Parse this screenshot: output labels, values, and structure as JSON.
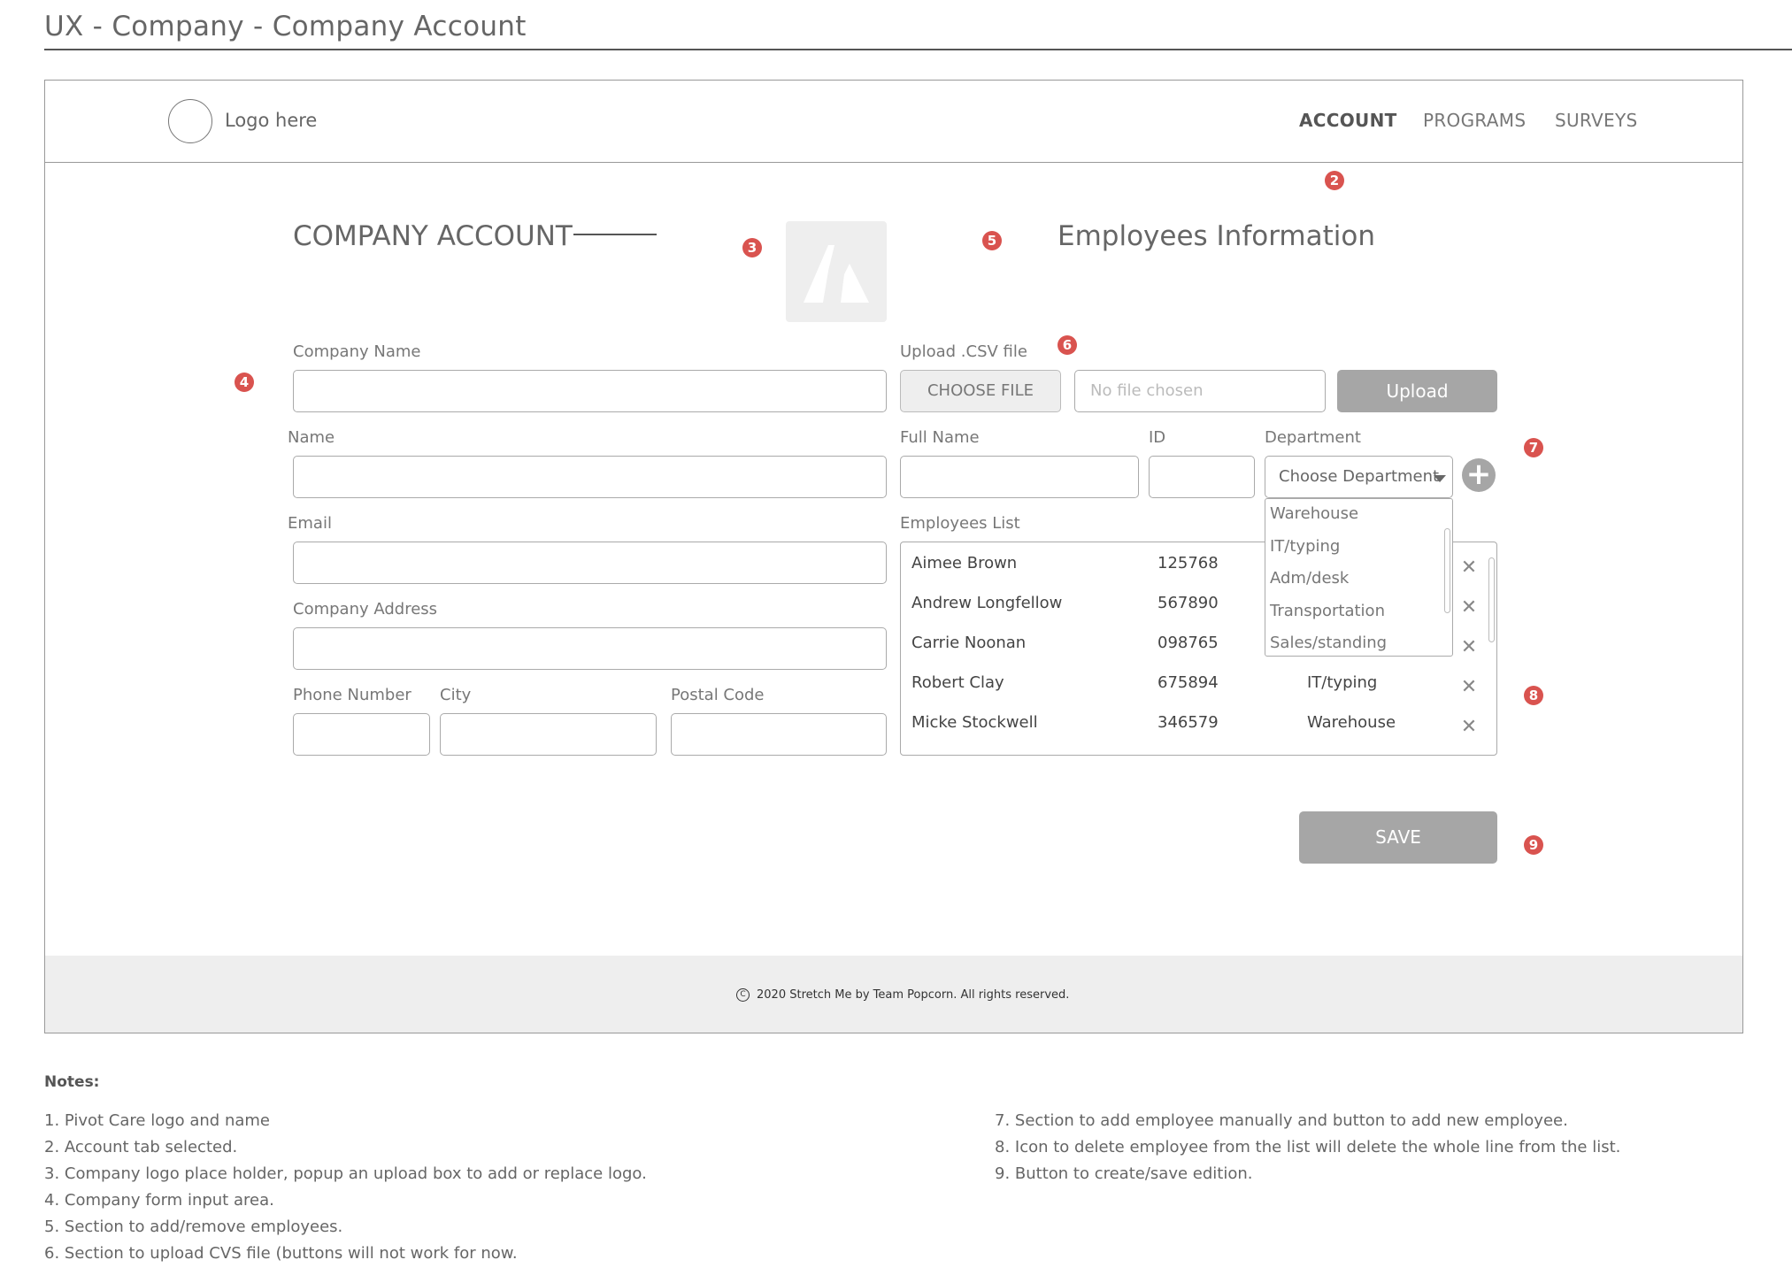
{
  "page_title": "UX - Company - Company Account",
  "header": {
    "logo_text": "Logo here",
    "nav": [
      "ACCOUNT",
      "PROGRAMS",
      "SURVEYS"
    ],
    "active_nav": "ACCOUNT"
  },
  "markers": [
    "2",
    "3",
    "4",
    "5",
    "6",
    "7",
    "8",
    "9"
  ],
  "company": {
    "title": "COMPANY ACCOUNT",
    "company_name_label": "Company Name",
    "name_label": "Name",
    "email_label": "Email",
    "address_label": "Company Address",
    "phone_label": "Phone Number",
    "city_label": "City",
    "postal_label": "Postal Code"
  },
  "employees": {
    "title": "Employees Information",
    "upload_label": "Upload .CSV file",
    "choose_file": "CHOOSE FILE",
    "no_file": "No file chosen",
    "upload_button": "Upload",
    "full_name_label": "Full Name",
    "id_label": "ID",
    "department_label": "Department",
    "department_placeholder": "Choose Department",
    "add_icon": "plus-circle-icon",
    "department_options": [
      "Warehouse",
      "IT/typing",
      "Adm/desk",
      "Transportation",
      "Sales/standing"
    ],
    "list_label": "Employees List",
    "list": [
      {
        "name": "Aimee Brown",
        "id": "125768",
        "department": ""
      },
      {
        "name": "Andrew Longfellow",
        "id": "567890",
        "department": ""
      },
      {
        "name": "Carrie Noonan",
        "id": "098765",
        "department": ""
      },
      {
        "name": "Robert Clay",
        "id": "675894",
        "department": "IT/typing"
      },
      {
        "name": "Micke Stockwell",
        "id": "346579",
        "department": "Warehouse"
      }
    ],
    "delete_icon": "close-icon"
  },
  "save_button": "SAVE",
  "footer": {
    "copyright_symbol": "C",
    "text": "2020 Stretch Me by Team Popcorn. All rights reserved."
  },
  "notes": {
    "title": "Notes:",
    "items": [
      "1. Pivot Care logo and name",
      "2. Account tab selected.",
      "3. Company logo place holder, popup an upload box to add or replace logo.",
      "4. Company form input area.",
      "5. Section to add/remove employees.",
      "6. Section to upload CVS file (buttons will not work for now.",
      "7. Section to add employee manually and button to add new employee.",
      "8. Icon to delete employee from the list will delete the whole line from the list.",
      "9. Button to create/save edition."
    ]
  },
  "colors": {
    "marker": "#d9534f",
    "button_gray": "#a6a6a6",
    "panel_gray": "#eeeeee"
  }
}
